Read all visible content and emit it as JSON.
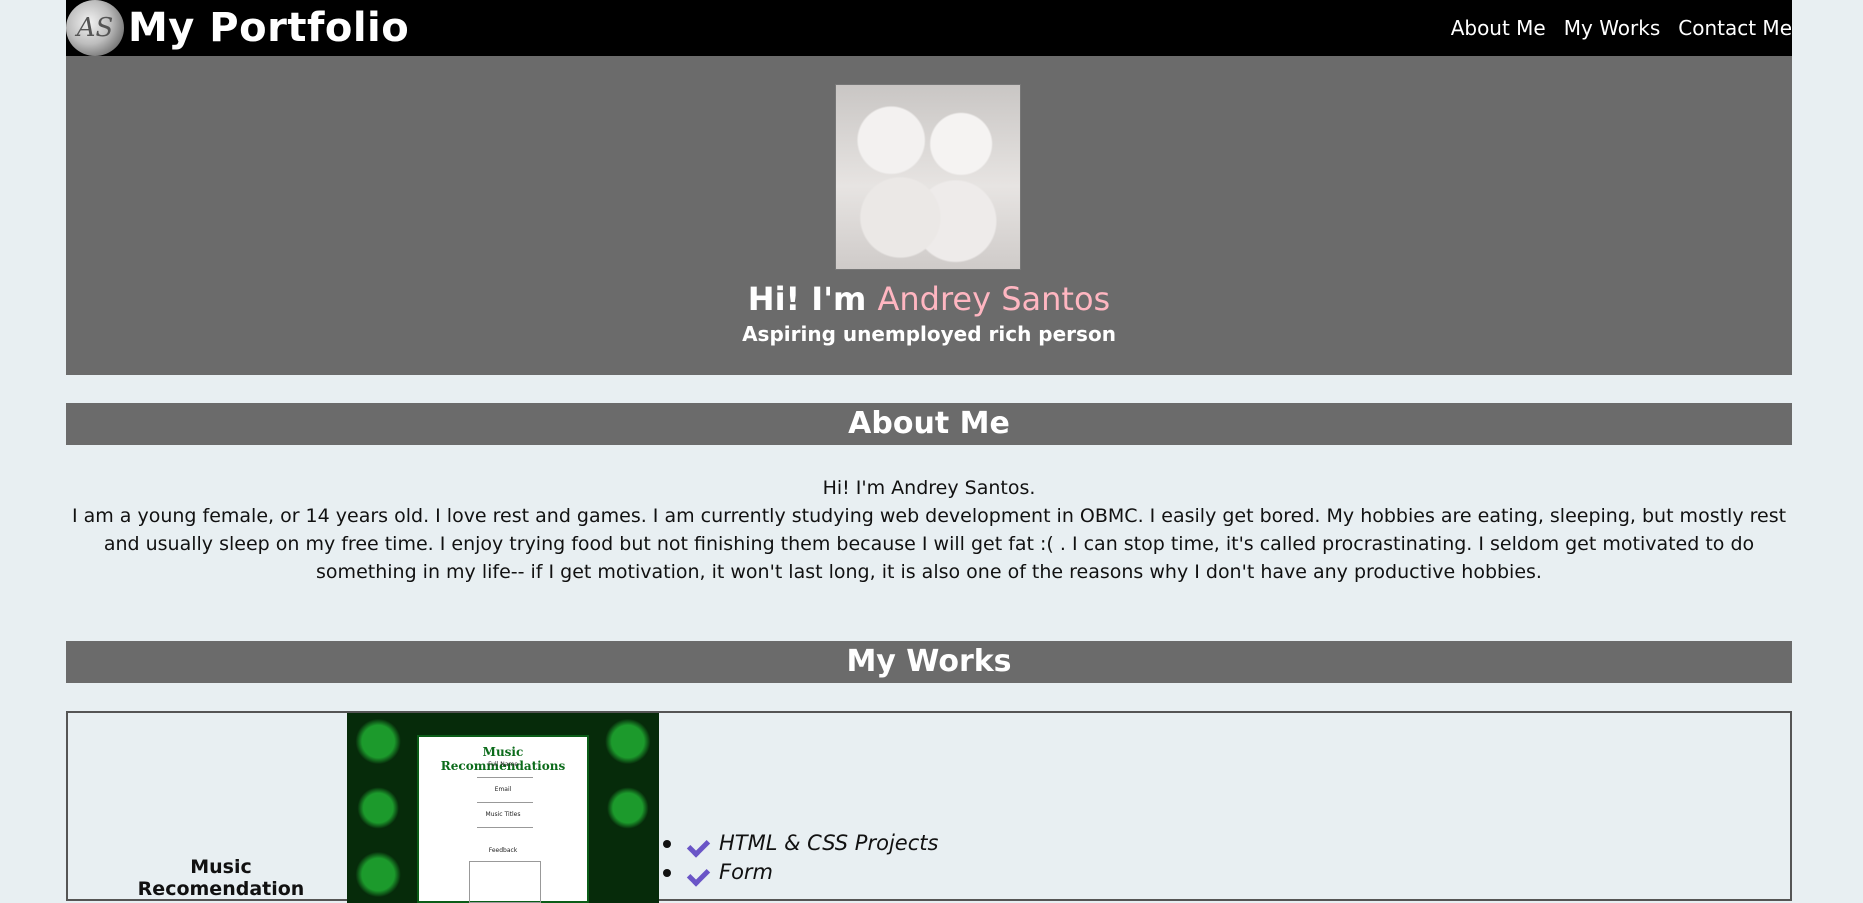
{
  "header": {
    "logo_letters": "AS",
    "title": "My Portfolio",
    "nav": [
      {
        "label": "About Me"
      },
      {
        "label": "My Works"
      },
      {
        "label": "Contact Me"
      }
    ]
  },
  "hero": {
    "greeting": "Hi! I'm ",
    "name": "Andrey Santos",
    "subtitle": "Aspiring unemployed rich person",
    "name_color": "#ffb6c1"
  },
  "about": {
    "heading": "About Me",
    "intro": "Hi! I'm Andrey Santos.",
    "body": "I am a young female, or 14 years old. I love rest and games. I am currently studying web development in OBMC. I easily get bored. My hobbies are eating, sleeping, but mostly rest and usually sleep on my free time. I enjoy trying food but not finishing them because I will get fat :( . I can stop time, it's called procrastinating. I seldom get motivated to do something in my life-- if I get motivation, it won't last long, it is also one of the reasons why I don't have any productive hobbies."
  },
  "works": {
    "heading": "My Works",
    "items": [
      {
        "title": "Music Recomendation",
        "thumbnail": {
          "heading": "Music Recommendations",
          "fields": [
            "Full Name",
            "Email",
            "Music Titles",
            "Feedback"
          ]
        },
        "tags": [
          "HTML & CSS Projects",
          "Form"
        ]
      }
    ]
  },
  "colors": {
    "page_bg": "#e8eff2",
    "header_bg": "#000000",
    "section_bg": "#6b6b6b",
    "check_icon": "#6a55c7"
  }
}
